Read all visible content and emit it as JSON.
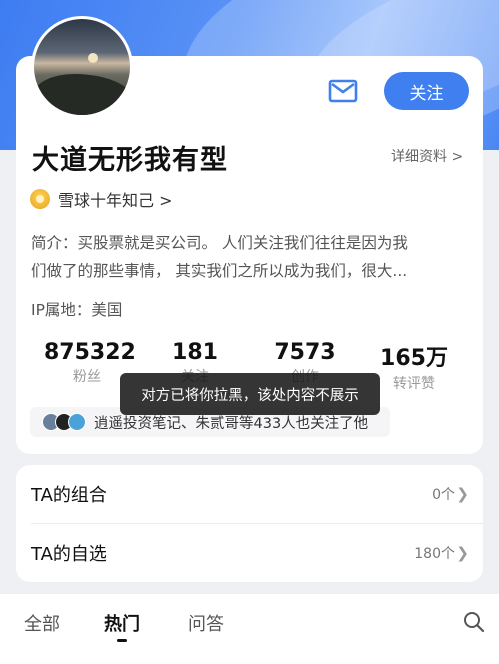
{
  "profile": {
    "name": "大道无形我有型",
    "detail_link": "详细资料 >",
    "badge": "雪球十年知己 >",
    "intro_line1": "简介：买股票就是买公司。 人们关注我们往往是因为我",
    "intro_line2": "们做了的那些事情， 其实我们之所以成为我们，很大...",
    "ip": "IP属地：美国",
    "follow_label": "关注"
  },
  "stats": [
    {
      "value": "875322",
      "label": "粉丝"
    },
    {
      "value": "181",
      "label": "关注"
    },
    {
      "value": "7573",
      "label": "创作"
    },
    {
      "value": "165万",
      "label": "转评赞"
    }
  ],
  "also_followed": "逍遥投资笔记、朱贰哥等433人也关注了他",
  "toast": "对方已将你拉黑，该处内容不展示",
  "list": [
    {
      "title": "TA的组合",
      "value": "0个"
    },
    {
      "title": "TA的自选",
      "value": "180个"
    }
  ],
  "tabs": [
    "全部",
    "热门",
    "问答"
  ],
  "colors": {
    "accent": "#3f7ff0"
  }
}
